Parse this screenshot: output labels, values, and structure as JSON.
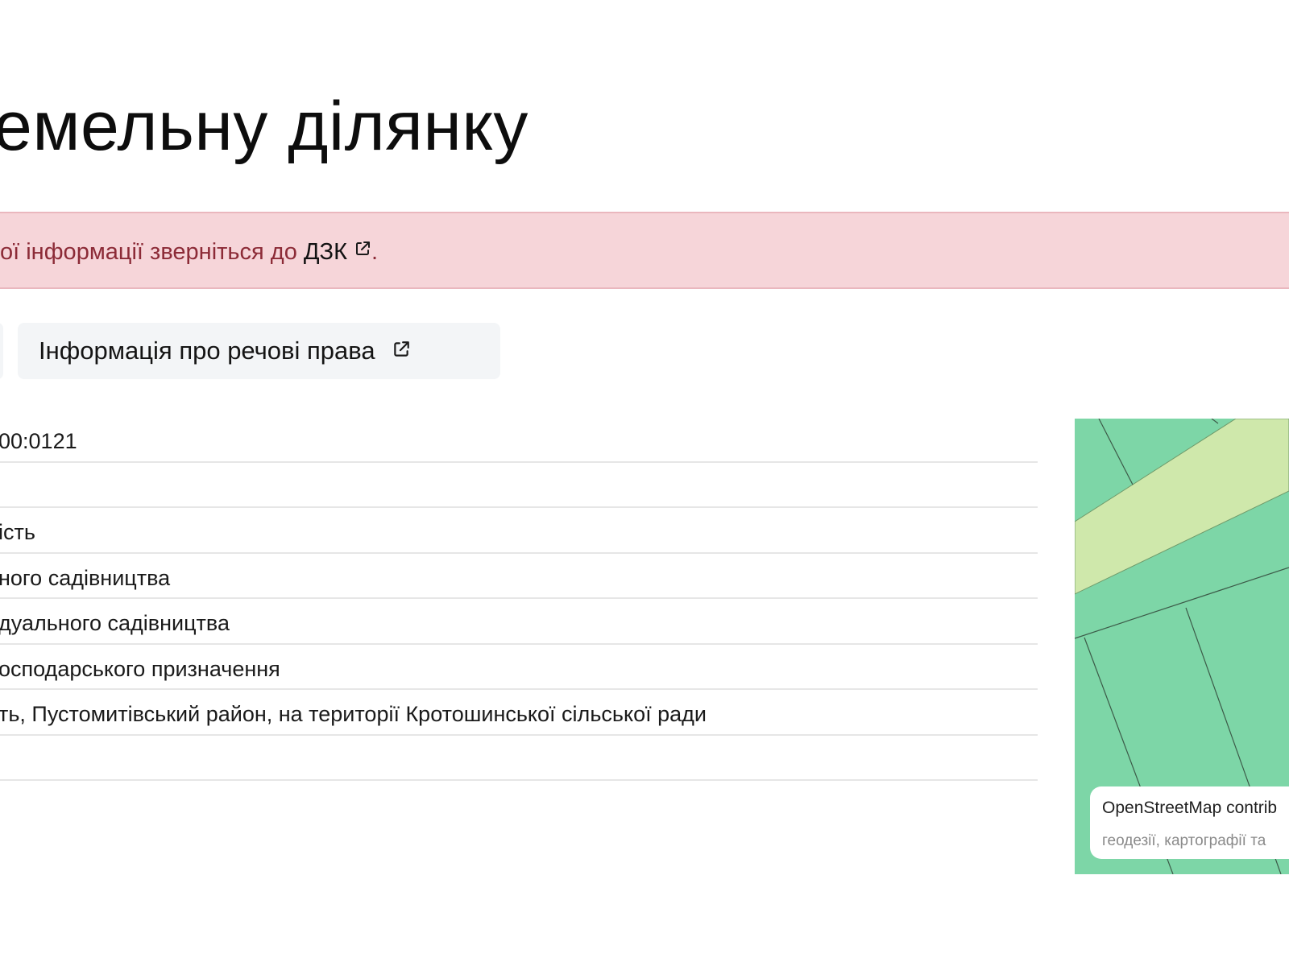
{
  "header": {
    "title": "емельну ділянку"
  },
  "alert": {
    "text_before": "ої інформації зверніться до ",
    "link_label": "ДЗК",
    "text_after": ".",
    "link_icon": "external-link-icon",
    "colors": {
      "background": "#f6d5d9",
      "text": "#8c2b37"
    }
  },
  "actions": {
    "rights_button_label": "Інформація про речові права",
    "rights_button_icon": "external-link-icon"
  },
  "details": {
    "rows": [
      "00:0121",
      "",
      "ість",
      "ного садівництва",
      "дуального садівництва",
      "осподарського призначення",
      "ть, Пустомитівський район, на території Кротошинської сільської ради",
      ""
    ]
  },
  "map": {
    "attribution_line1": "OpenStreetMap contrib",
    "attribution_line2": "геодезії, картографії та",
    "colors": {
      "parcel": "#7dd6a7",
      "road": "#cfe8ab",
      "boundary": "#3c5a48"
    }
  }
}
